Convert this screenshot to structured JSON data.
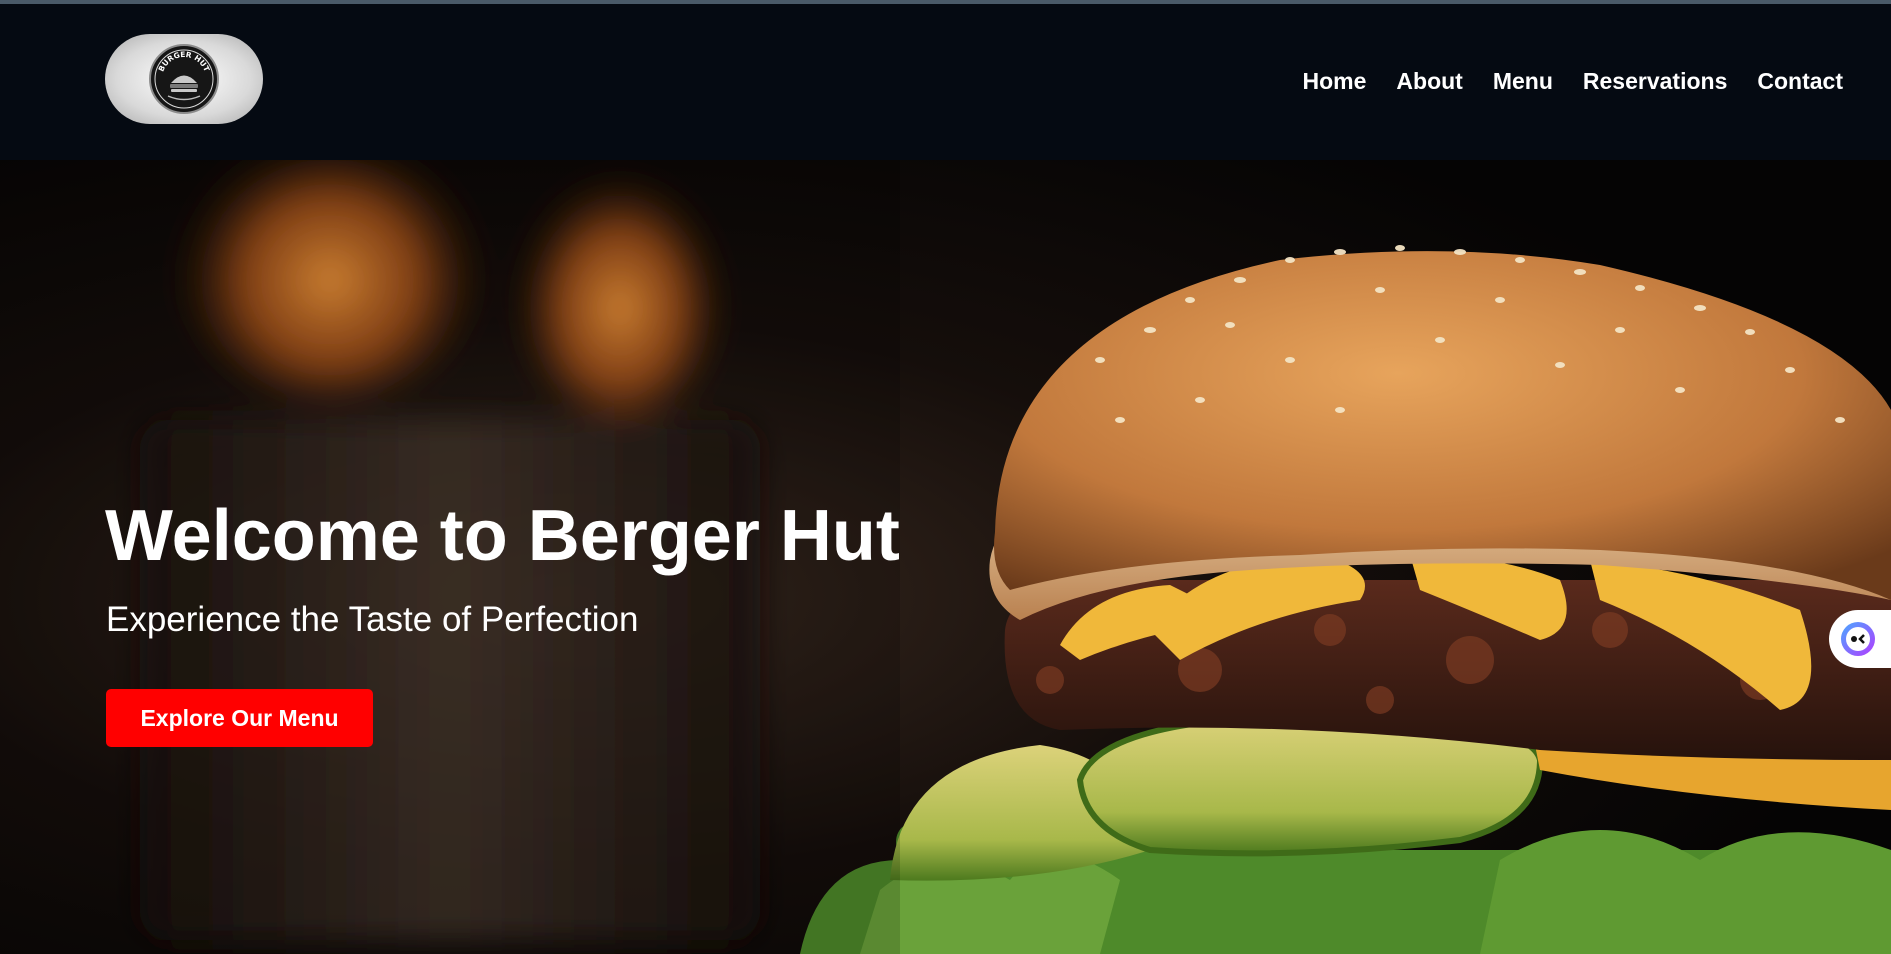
{
  "brand": {
    "logo_alt": "Berger Hut logo",
    "logo_text_top": "BURGER HUT"
  },
  "nav": {
    "items": [
      "Home",
      "About",
      "Menu",
      "Reservations",
      "Contact"
    ]
  },
  "hero": {
    "title": "Welcome to Berger Hut",
    "subtitle": "Experience the Taste of Perfection",
    "cta_label": "Explore Our Menu"
  },
  "colors": {
    "navbar_bg": "#050a12",
    "cta_bg": "#ff0000",
    "text": "#ffffff"
  },
  "icons": {
    "chat": "chat-assistant-icon"
  }
}
